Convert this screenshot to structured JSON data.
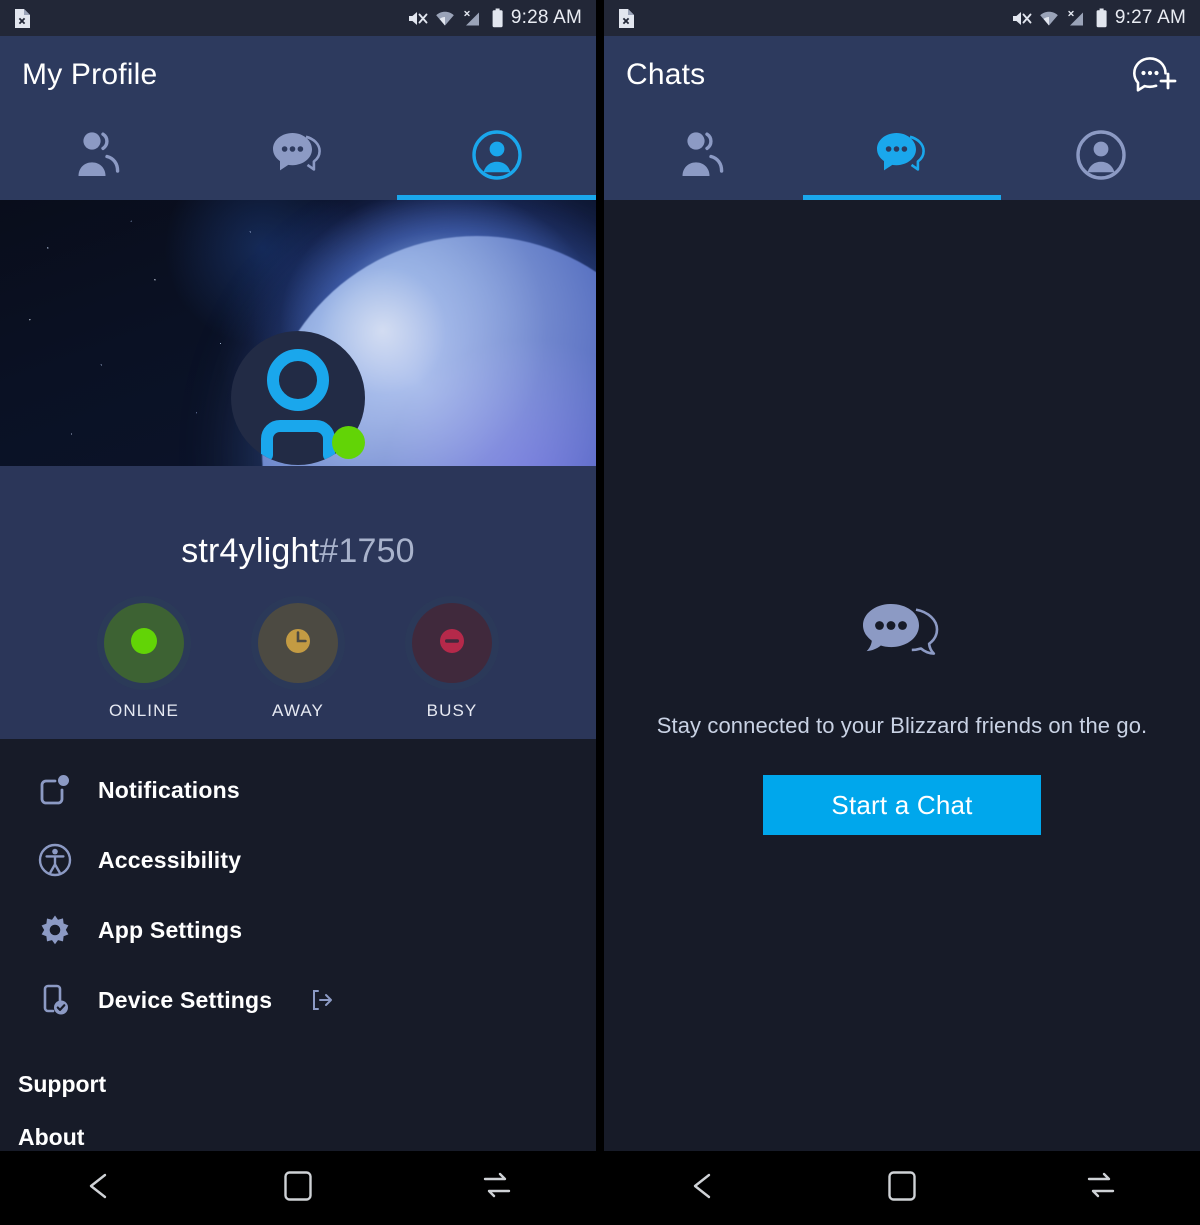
{
  "colors": {
    "status_bar_bg": "#222737",
    "app_bar_bg": "#2d3a5e",
    "content_bg": "#171b28",
    "profile_bg": "#2b3659",
    "accent_blue": "#1aa7ec",
    "button_blue": "#00a7ec",
    "online_green": "#62d406",
    "away_yellow": "#c39b43",
    "busy_red": "#b5294a",
    "icon_muted": "#8c9ac4",
    "text_primary": "#ffffff",
    "text_secondary": "#a9b3cc"
  },
  "left_screen": {
    "status_bar": {
      "left_icon": "file-x-icon",
      "icons": [
        "mute-icon",
        "wifi-icon",
        "cellular-no-signal-icon",
        "battery-icon"
      ],
      "time": "9:28 AM"
    },
    "header": {
      "title": "My Profile"
    },
    "tabs": [
      {
        "label": "Friends",
        "icon": "friends-icon",
        "active": false
      },
      {
        "label": "Chats",
        "icon": "chat-bubble-icon",
        "active": false
      },
      {
        "label": "Profile",
        "icon": "person-circle-icon",
        "active": true
      }
    ],
    "profile": {
      "banner_alt": "space-planet-banner",
      "avatar_icon": "person-avatar-icon",
      "presence": "online",
      "battletag_name": "str4ylight",
      "battletag_number": "#1750"
    },
    "status_options": [
      {
        "label": "ONLINE",
        "icon": "dot-icon",
        "selected": true
      },
      {
        "label": "AWAY",
        "icon": "clock-icon",
        "selected": false
      },
      {
        "label": "BUSY",
        "icon": "minus-circle-icon",
        "selected": false
      }
    ],
    "menu_items": [
      {
        "label": "Notifications",
        "icon": "notification-badge-icon",
        "external": false
      },
      {
        "label": "Accessibility",
        "icon": "accessibility-icon",
        "external": false
      },
      {
        "label": "App Settings",
        "icon": "gear-icon",
        "external": false
      },
      {
        "label": "Device Settings",
        "icon": "device-check-icon",
        "external": true
      }
    ],
    "sections": [
      {
        "label": "Support"
      },
      {
        "label": "About"
      }
    ]
  },
  "right_screen": {
    "status_bar": {
      "left_icon": "file-x-icon",
      "icons": [
        "mute-icon",
        "wifi-icon",
        "cellular-no-signal-icon",
        "battery-icon"
      ],
      "time": "9:27 AM"
    },
    "header": {
      "title": "Chats",
      "action_icon": "new-chat-icon"
    },
    "tabs": [
      {
        "label": "Friends",
        "icon": "friends-icon",
        "active": false
      },
      {
        "label": "Chats",
        "icon": "chat-bubble-icon",
        "active": true
      },
      {
        "label": "Profile",
        "icon": "person-circle-icon",
        "active": false
      }
    ],
    "empty_state": {
      "icon": "chat-bubbles-icon",
      "message": "Stay connected to your Blizzard friends on the go.",
      "button_label": "Start a Chat"
    }
  },
  "nav_bar": {
    "buttons": [
      {
        "name": "back",
        "icon": "back-arrow-icon"
      },
      {
        "name": "home",
        "icon": "home-square-icon"
      },
      {
        "name": "recents",
        "icon": "recents-icon"
      }
    ]
  }
}
